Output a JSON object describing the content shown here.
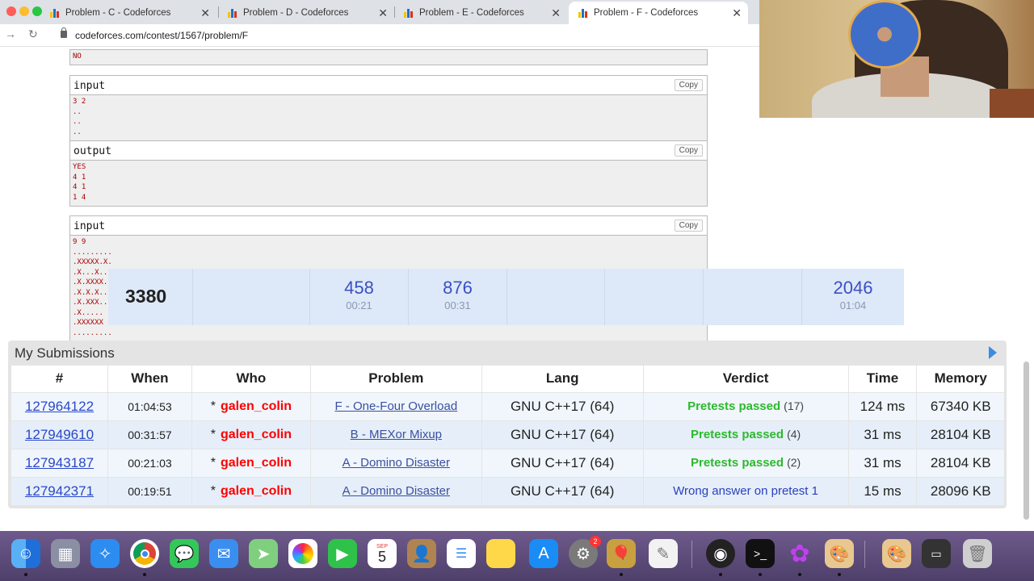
{
  "browser": {
    "tabs": [
      {
        "title": "Problem - C - Codeforces",
        "active": false
      },
      {
        "title": "Problem - D - Codeforces",
        "active": false
      },
      {
        "title": "Problem - E - Codeforces",
        "active": false
      },
      {
        "title": "Problem - F - Codeforces",
        "active": true
      }
    ],
    "url": "codeforces.com/contest/1567/problem/F"
  },
  "samples": {
    "prev_output_tail": "NO",
    "blocks": [
      {
        "label": "input",
        "copy": "Copy",
        "text": "3 2\n..\n..\n.."
      },
      {
        "label": "output",
        "copy": "Copy",
        "text": "YES\n4 1\n4 1\n1 4"
      },
      {
        "label": "input",
        "copy": "Copy",
        "text": "9 9\n.........\n.XXXXX.X.\n.X...X...\n.X.XXXX..\n.X.X.X...\n.X.XXX...\n.X.....\n.XXXXXX\n........."
      }
    ]
  },
  "standings": {
    "score": "3380",
    "problems": [
      {
        "points": "",
        "time": ""
      },
      {
        "points": "458",
        "time": "00:21"
      },
      {
        "points": "876",
        "time": "00:31"
      },
      {
        "points": "",
        "time": ""
      },
      {
        "points": "",
        "time": ""
      },
      {
        "points": "",
        "time": ""
      },
      {
        "points": "2046",
        "time": "01:04"
      }
    ]
  },
  "submissions": {
    "title": "My Submissions",
    "columns": [
      "#",
      "When",
      "Who",
      "Problem",
      "Lang",
      "Verdict",
      "Time",
      "Memory"
    ],
    "rows": [
      {
        "id": "127964122",
        "when": "01:04:53",
        "who": "galen_colin",
        "problem": "F - One-Four Overload",
        "lang": "GNU C++17 (64)",
        "verdict": "Pretests passed",
        "tests": "(17)",
        "ok": true,
        "time": "124 ms",
        "memory": "67340 KB"
      },
      {
        "id": "127949610",
        "when": "00:31:57",
        "who": "galen_colin",
        "problem": "B - MEXor Mixup",
        "lang": "GNU C++17 (64)",
        "verdict": "Pretests passed",
        "tests": "(4)",
        "ok": true,
        "time": "31 ms",
        "memory": "28104 KB"
      },
      {
        "id": "127943187",
        "when": "00:21:03",
        "who": "galen_colin",
        "problem": "A - Domino Disaster",
        "lang": "GNU C++17 (64)",
        "verdict": "Pretests passed",
        "tests": "(2)",
        "ok": true,
        "time": "31 ms",
        "memory": "28104 KB"
      },
      {
        "id": "127942371",
        "when": "00:19:51",
        "who": "galen_colin",
        "problem": "A - Domino Disaster",
        "lang": "GNU C++17 (64)",
        "verdict": "Wrong answer on pretest 1",
        "tests": "",
        "ok": false,
        "time": "15 ms",
        "memory": "28096 KB"
      }
    ]
  },
  "dock": {
    "calendar_month": "SEP",
    "calendar_day": "5",
    "badge": "2",
    "apps": [
      "finder-icon",
      "launchpad-icon",
      "safari-icon",
      "chrome-icon",
      "messages-icon",
      "mail-icon",
      "maps-icon",
      "photos-icon",
      "facetime-icon",
      "calendar-icon",
      "contacts-icon",
      "reminders-icon",
      "notes-icon",
      "app-store-icon",
      "system-preferences-icon",
      "game-icon",
      "textedit-icon",
      "obs-icon",
      "terminal-icon",
      "flower-app-icon",
      "paint-icon",
      "paint2-icon",
      "screenshot-icon",
      "trash-icon"
    ]
  },
  "colors": {
    "link": "#2a47c9",
    "user_red": "#ff0000",
    "accepted": "#2eb82e",
    "wrong_answer": "#2a3fbe",
    "standings_bg": "#dde9f8"
  }
}
